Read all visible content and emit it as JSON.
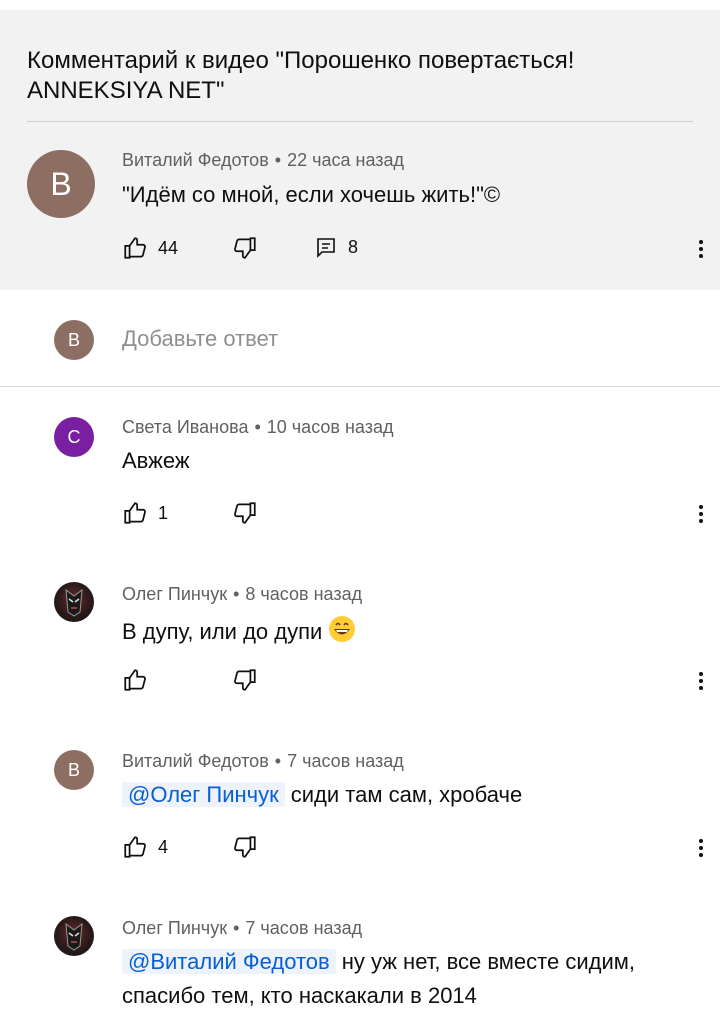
{
  "header": {
    "title": "Комментарий к видео \"Порошенко повертається! ANNEKSIYA NET\""
  },
  "main_comment": {
    "avatar_letter": "В",
    "avatar_color": "#8d6e63",
    "author": "Виталий Федотов",
    "time": "22 часа назад",
    "text": "\"Идём со мной, если хочешь жить!\"©",
    "likes": "44",
    "replies": "8"
  },
  "reply_input": {
    "avatar_letter": "В",
    "placeholder": "Добавьте ответ"
  },
  "replies": [
    {
      "avatar_letter": "С",
      "avatar_color": "#7b1fa2",
      "author": "Света Иванова",
      "time": "10 часов назад",
      "text": "Авжеж",
      "likes": "1"
    },
    {
      "avatar_icon": "dark-knight-avatar",
      "author": "Олег Пинчук",
      "time": "8 часов назад",
      "text": "В дупу, или до дупи",
      "emoji": "grinning-face-icon",
      "likes": ""
    },
    {
      "avatar_letter": "В",
      "avatar_color": "#8d6e63",
      "author": "Виталий Федотов",
      "time": "7 часов назад",
      "mention": "@Олег Пинчук",
      "text": "сиди там сам, хробаче",
      "likes": "4"
    },
    {
      "avatar_icon": "dark-knight-avatar",
      "author": "Олег Пинчук",
      "time": "7 часов назад",
      "mention": "@Виталий Федотов",
      "text": "ну уж нет, все вместе сидим, спасибо тем, кто наскакали в 2014",
      "likes": ""
    }
  ],
  "colors": {
    "link": "#065fd4",
    "meta": "#606060",
    "header_bg": "#f2f2f2"
  }
}
